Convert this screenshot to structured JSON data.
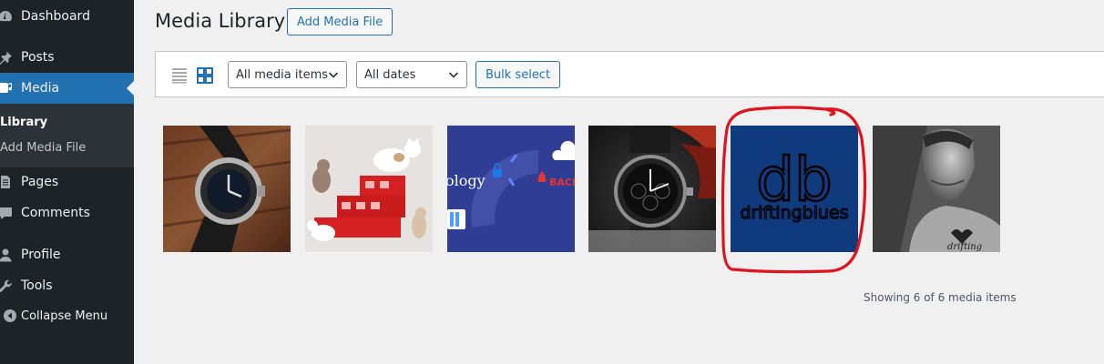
{
  "sidebar": {
    "items": [
      {
        "label": "Dashboard",
        "icon": "dashboard-icon"
      },
      {
        "label": "Posts",
        "icon": "pushpin-icon"
      },
      {
        "label": "Media",
        "icon": "media-icon"
      },
      {
        "label": "Pages",
        "icon": "page-icon"
      },
      {
        "label": "Comments",
        "icon": "comment-icon"
      },
      {
        "label": "Profile",
        "icon": "user-icon"
      },
      {
        "label": "Tools",
        "icon": "wrench-icon"
      },
      {
        "label": "Collapse Menu",
        "icon": "collapse-icon"
      }
    ],
    "submenu": [
      {
        "label": "Library"
      },
      {
        "label": "Add Media File"
      }
    ]
  },
  "header": {
    "title": "Media Library",
    "add_button": "Add Media File"
  },
  "toolbar": {
    "filter_type": "All media items",
    "filter_date": "All dates",
    "bulk_select": "Bulk select"
  },
  "grid": {
    "items": [
      {
        "description": "wristwatch on wood",
        "icon": "watch-image"
      },
      {
        "description": "cats on red blocks",
        "icon": "cats-image"
      },
      {
        "description": "synology backup banner",
        "icon": "banner-image",
        "text": "ology",
        "text2": "BACK"
      },
      {
        "description": "chronograph watch",
        "icon": "watch-image"
      },
      {
        "description": "driftingblues logo",
        "icon": "logo-image",
        "logo_letters": "db",
        "logo_word": "driftingblues"
      },
      {
        "description": "portrait man",
        "icon": "portrait-image",
        "text": "drifting"
      }
    ],
    "count_text": "Showing 6 of 6 media items"
  },
  "colors": {
    "sidebar_bg": "#1d2327",
    "accent": "#2271b1",
    "annotation": "#e0141e",
    "logo_bg": "#0f3a7e"
  }
}
